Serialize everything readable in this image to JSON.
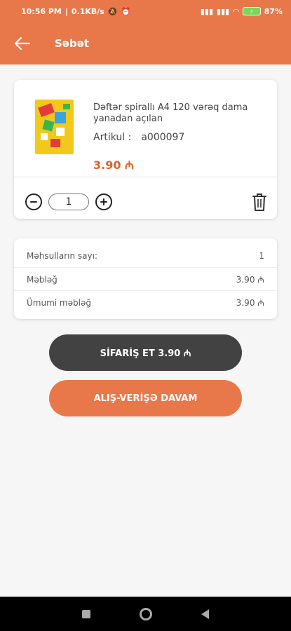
{
  "status_bar": {
    "time": "10:56 PM",
    "speed": "0.1KB/s",
    "battery": "87%"
  },
  "header": {
    "title": "Səbət",
    "back_icon": "arrow-left-icon"
  },
  "cart": {
    "items": [
      {
        "name": "Dəftər spirallı A4 120 vərəq dama yanadan açılan",
        "article_label": "Artikul :",
        "article_value": "a000097",
        "price": "3.90 ₼",
        "quantity": "1"
      }
    ]
  },
  "summary": {
    "rows": [
      {
        "label": "Məhsulların sayı:",
        "value": "1"
      },
      {
        "label": "Məbləğ",
        "value": "3.90 ₼"
      },
      {
        "label": "Ümumi məbləğ",
        "value": "3.90 ₼"
      }
    ]
  },
  "actions": {
    "order_label": "SİFARİŞ ET 3.90 ₼",
    "continue_label": "ALIŞ-VERİŞƏ DAVAM"
  },
  "colors": {
    "accent": "#e8784a",
    "price": "#e0622a",
    "order_button": "#424242"
  }
}
